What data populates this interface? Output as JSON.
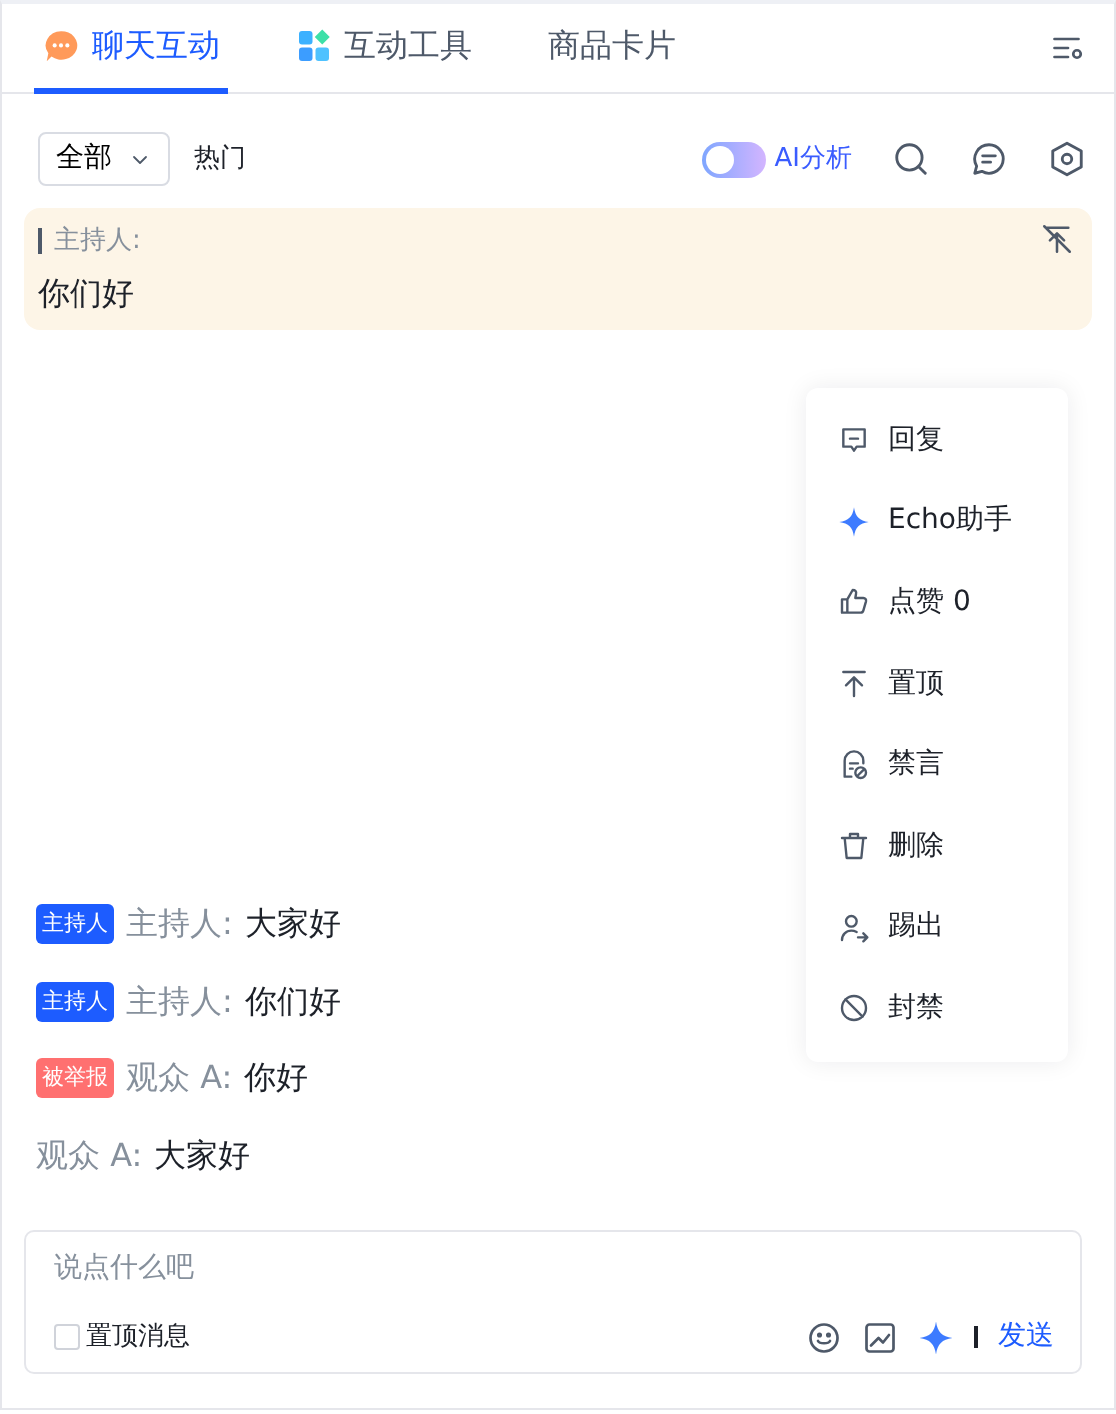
{
  "tabs": [
    {
      "label": "聊天互动",
      "kind": "chat",
      "selected": true
    },
    {
      "label": "互动工具",
      "kind": "tools",
      "selected": false
    },
    {
      "label": "商品卡片",
      "kind": "plain",
      "selected": false
    }
  ],
  "toolbar": {
    "filter": "全部",
    "hot": "热门",
    "ai_toggle": {
      "label": "AI分析",
      "on": false
    }
  },
  "pinned": {
    "sender": "主持人:",
    "text": "你们好"
  },
  "context_menu": [
    {
      "kind": "reply",
      "label": "回复"
    },
    {
      "kind": "sparkle",
      "label": "Echo助手"
    },
    {
      "kind": "like",
      "label": "点赞 0"
    },
    {
      "kind": "top",
      "label": "置顶"
    },
    {
      "kind": "mute",
      "label": "禁言"
    },
    {
      "kind": "delete",
      "label": "删除"
    },
    {
      "kind": "kick",
      "label": "踢出"
    },
    {
      "kind": "ban",
      "label": "封禁"
    }
  ],
  "messages": [
    {
      "badge": {
        "text": "主持人",
        "kind": "host"
      },
      "sender": "主持人:",
      "text": "大家好"
    },
    {
      "badge": {
        "text": "主持人",
        "kind": "host"
      },
      "sender": "主持人:",
      "text": "你们好"
    },
    {
      "badge": {
        "text": "被举报",
        "kind": "reported"
      },
      "sender": "观众 A:",
      "text": "你好"
    },
    {
      "sender": "观众 A:",
      "text": "大家好"
    }
  ],
  "composer": {
    "placeholder": "说点什么吧",
    "pin_message": {
      "label": "置顶消息",
      "checked": false
    },
    "send": "发送"
  }
}
